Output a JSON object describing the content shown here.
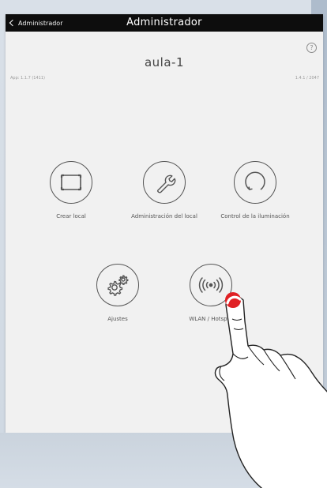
{
  "navbar": {
    "back_label": "Administrador",
    "title": "Administrador"
  },
  "header": {
    "room_name": "aula-1",
    "help_symbol": "?",
    "meta_left": "App: 1.1.7 (1411)",
    "meta_right": "1.4.1 / 2047"
  },
  "tiles": [
    {
      "label": "Crear local",
      "icon": "screen-icon"
    },
    {
      "label": "Administración del local",
      "icon": "wrench-icon"
    },
    {
      "label": "Control de la iluminación",
      "icon": "refresh-icon"
    },
    {
      "label": "Ajustes",
      "icon": "gears-icon"
    },
    {
      "label": "WLAN / Hotspot",
      "icon": "wifi-broadcast-icon"
    }
  ],
  "colors": {
    "navbar": "#0d0d0d",
    "screen_bg": "#f1f1f1",
    "icon_stroke": "#555555",
    "touch_marker": "#e02024"
  }
}
